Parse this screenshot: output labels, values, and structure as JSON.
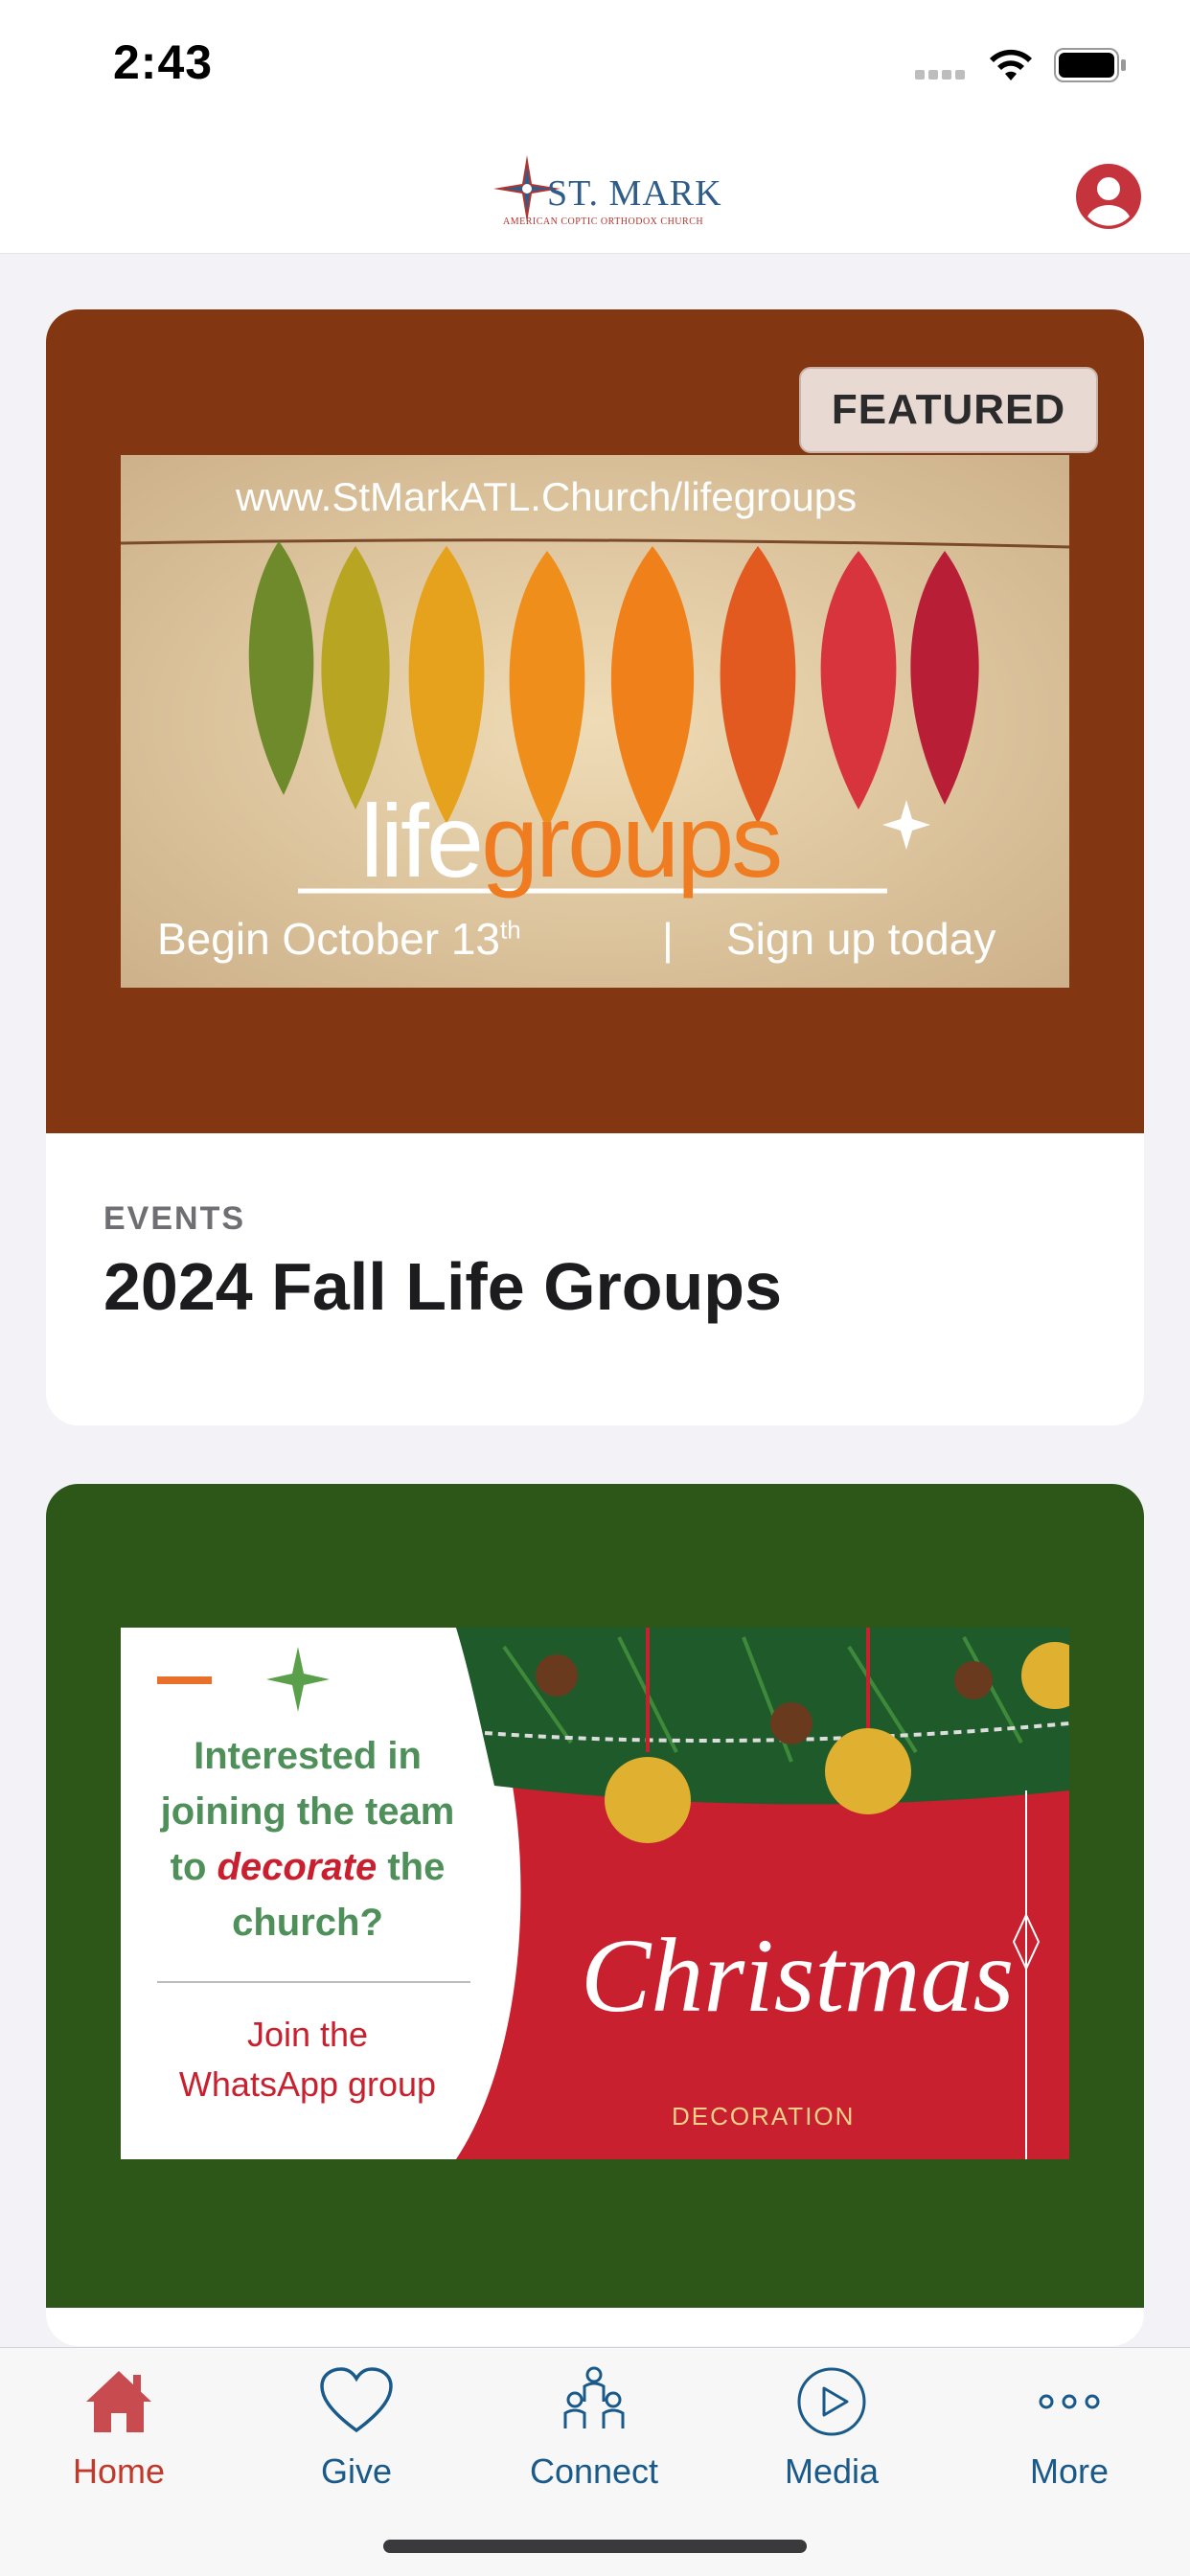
{
  "status_bar": {
    "time": "2:43"
  },
  "header": {
    "logo_text": "ST. MARK",
    "logo_subtitle": "AMERICAN COPTIC ORTHODOX CHURCH"
  },
  "cards": [
    {
      "badge": "FEATURED",
      "image": {
        "url_text": "www.StMarkATL.Church/lifegroups",
        "brand_part1": "life",
        "brand_part2": "groups",
        "begin_text": "Begin October 13",
        "begin_suffix": "th",
        "separator": "|",
        "signup_text": "Sign up today"
      },
      "category": "EVENTS",
      "title": "2024 Fall Life Groups",
      "banner_color": "#833612"
    },
    {
      "image": {
        "line1": "Interested in",
        "line2": "joining the team",
        "line3_a": "to ",
        "line3_b": "decorate",
        "line3_c": " the",
        "line4": "church?",
        "join1": "Join the",
        "join2": "WhatsApp group",
        "script": "Christmas",
        "subtitle": "DECORATION"
      },
      "banner_color": "#2c5718"
    }
  ],
  "tabs": [
    {
      "label": "Home",
      "icon": "home-icon",
      "active": true
    },
    {
      "label": "Give",
      "icon": "heart-icon",
      "active": false
    },
    {
      "label": "Connect",
      "icon": "people-icon",
      "active": false
    },
    {
      "label": "Media",
      "icon": "play-icon",
      "active": false
    },
    {
      "label": "More",
      "icon": "more-icon",
      "active": false
    }
  ],
  "colors": {
    "accent_active": "#c0392b",
    "tab_inactive": "#1a5a8a",
    "background": "#f2f2f7"
  }
}
